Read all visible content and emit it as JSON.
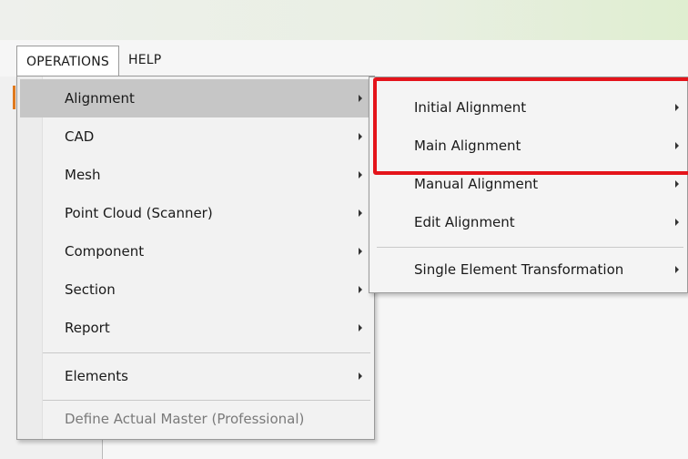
{
  "menubar": {
    "items": [
      {
        "label": "OPERATIONS"
      },
      {
        "label": "HELP"
      }
    ]
  },
  "operations_menu": {
    "items": [
      {
        "label": "Alignment",
        "has_submenu": true,
        "highlighted": true
      },
      {
        "label": "CAD",
        "has_submenu": true
      },
      {
        "label": "Mesh",
        "has_submenu": true
      },
      {
        "label": "Point Cloud (Scanner)",
        "has_submenu": true
      },
      {
        "label": "Component",
        "has_submenu": true
      },
      {
        "label": "Section",
        "has_submenu": true
      },
      {
        "label": "Report",
        "has_submenu": true
      },
      {
        "label": "Elements",
        "has_submenu": true
      },
      {
        "label": "Define Actual Master (Professional)",
        "has_submenu": false,
        "disabled": true
      }
    ]
  },
  "alignment_submenu": {
    "items": [
      {
        "label": "Initial Alignment",
        "has_submenu": true
      },
      {
        "label": "Main Alignment",
        "has_submenu": true
      },
      {
        "label": "Manual Alignment",
        "has_submenu": true
      },
      {
        "label": "Edit Alignment",
        "has_submenu": true
      },
      {
        "label": "Single Element Transformation",
        "has_submenu": true
      }
    ]
  },
  "colors": {
    "highlight_box": "#e4141b",
    "hover_item": "#c6c6c6",
    "accent": "#e07a1f"
  }
}
